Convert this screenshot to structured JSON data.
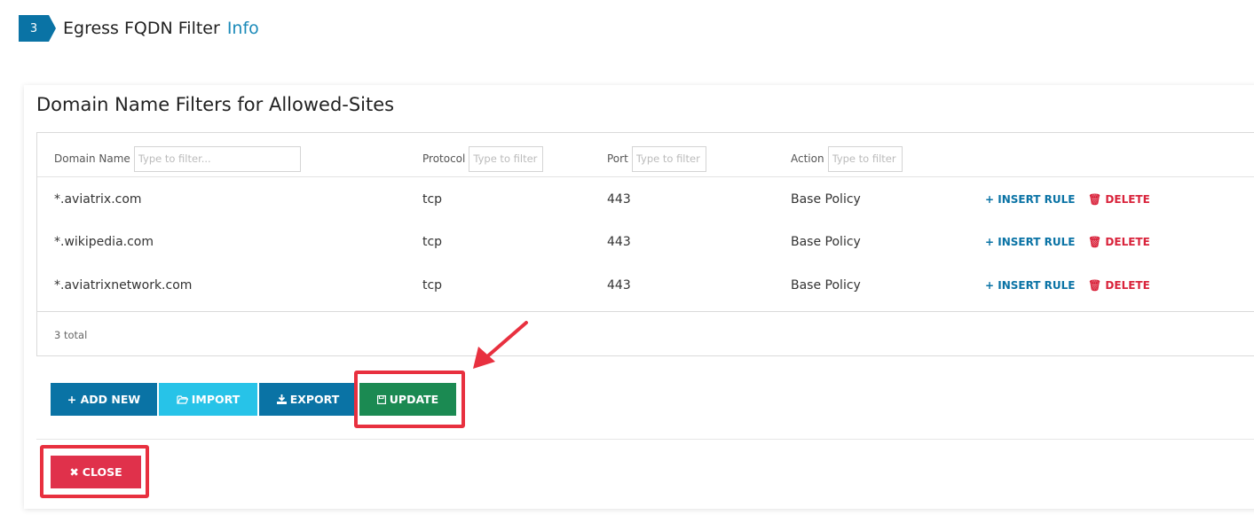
{
  "step": {
    "number": "3",
    "title": "Egress FQDN Filter",
    "info_link": "Info"
  },
  "card": {
    "title": "Domain Name Filters for Allowed-Sites"
  },
  "table": {
    "columns": [
      {
        "label": "Domain Name",
        "placeholder": "Type to filter..."
      },
      {
        "label": "Protocol",
        "placeholder": "Type to filter"
      },
      {
        "label": "Port",
        "placeholder": "Type to filter"
      },
      {
        "label": "Action",
        "placeholder": "Type to filter"
      }
    ],
    "rows": [
      {
        "domain": "*.aviatrix.com",
        "protocol": "tcp",
        "port": "443",
        "action": "Base Policy"
      },
      {
        "domain": "*.wikipedia.com",
        "protocol": "tcp",
        "port": "443",
        "action": "Base Policy"
      },
      {
        "domain": "*.aviatrixnetwork.com",
        "protocol": "tcp",
        "port": "443",
        "action": "Base Policy"
      }
    ],
    "row_actions": {
      "insert_label": "+ INSERT RULE",
      "delete_label": "DELETE"
    },
    "total": "3 total"
  },
  "buttons": {
    "add_new": "+ ADD NEW",
    "import": "IMPORT",
    "export": "EXPORT",
    "update": "UPDATE",
    "close": "CLOSE"
  },
  "colors": {
    "primary": "#0a73a5",
    "import": "#27c3e8",
    "update": "#1b8a52",
    "close": "#e0314b",
    "annotation": "#e8303f"
  }
}
